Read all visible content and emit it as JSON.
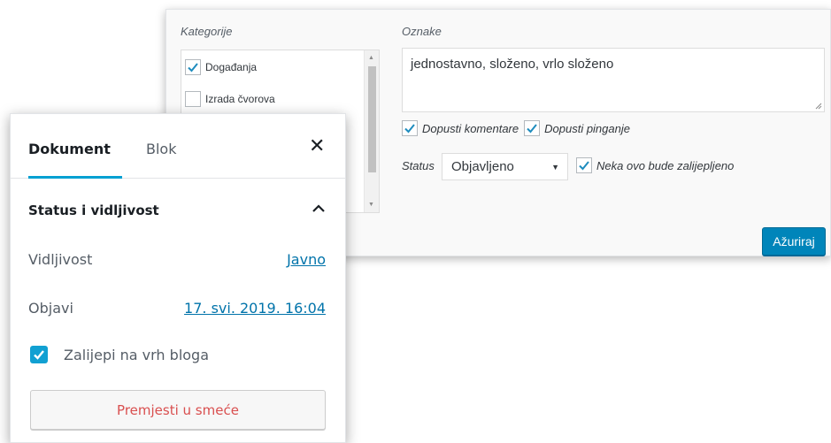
{
  "quick_edit": {
    "categories_label": "Kategorije",
    "tags_label": "Oznake",
    "categories": [
      {
        "label": "Događanja",
        "checked": true
      },
      {
        "label": "Izrada čvorova",
        "checked": false
      }
    ],
    "tags_value": "jednostavno, složeno, vrlo složeno",
    "allow_comments_label": "Dopusti komentare",
    "allow_comments_checked": true,
    "allow_pings_label": "Dopusti pinganje",
    "allow_pings_checked": true,
    "status_label": "Status",
    "status_value": "Objavljeno",
    "sticky_label": "Neka ovo bude zalijepljeno",
    "sticky_checked": true,
    "update_button": "Ažuriraj"
  },
  "sidebar": {
    "tabs": [
      {
        "label": "Dokument",
        "active": true
      },
      {
        "label": "Blok",
        "active": false
      }
    ],
    "close_icon": "close-icon",
    "panel_title": "Status i vidljivost",
    "visibility_label": "Vidljivost",
    "visibility_value": "Javno",
    "publish_label": "Objavi",
    "publish_value": "17. svi. 2019. 16:04",
    "stick_to_top_label": "Zalijepi na vrh bloga",
    "stick_to_top_checked": true,
    "trash_button": "Premjesti u smeće"
  },
  "colors": {
    "accent": "#00a0d2",
    "link": "#0073aa",
    "primary_button": "#0085ba",
    "danger_text": "#d94f4f"
  }
}
